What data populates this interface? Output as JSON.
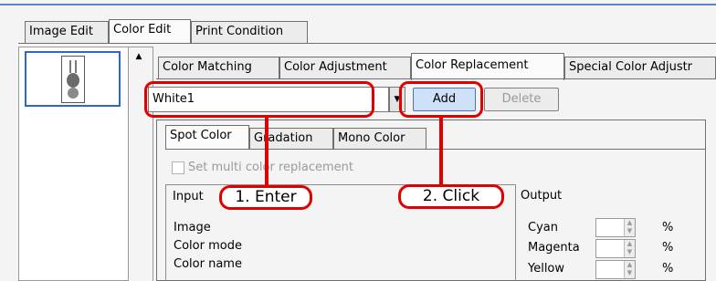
{
  "main_tabs": [
    "Image Edit",
    "Color Edit",
    "Print Condition"
  ],
  "sub_tabs": [
    "Color Matching",
    "Color Adjustment",
    "Color Replacement",
    "Special Color Adjustr"
  ],
  "replacement": {
    "combo_value": "White1",
    "add_label": "Add",
    "delete_label": "Delete"
  },
  "inner_tabs": [
    "Spot Color",
    "Gradation",
    "Mono Color"
  ],
  "multi_color_label": "Set multi color replacement",
  "input_group": {
    "title": "Input",
    "rows": [
      "Image",
      "Color mode",
      "Color name"
    ]
  },
  "output_group": {
    "title": "Output",
    "rows": [
      "Cyan",
      "Magenta",
      "Yellow"
    ],
    "unit": "%"
  },
  "annotations": {
    "enter": "1. Enter",
    "click": "2. Click",
    "color": "#e10000"
  }
}
